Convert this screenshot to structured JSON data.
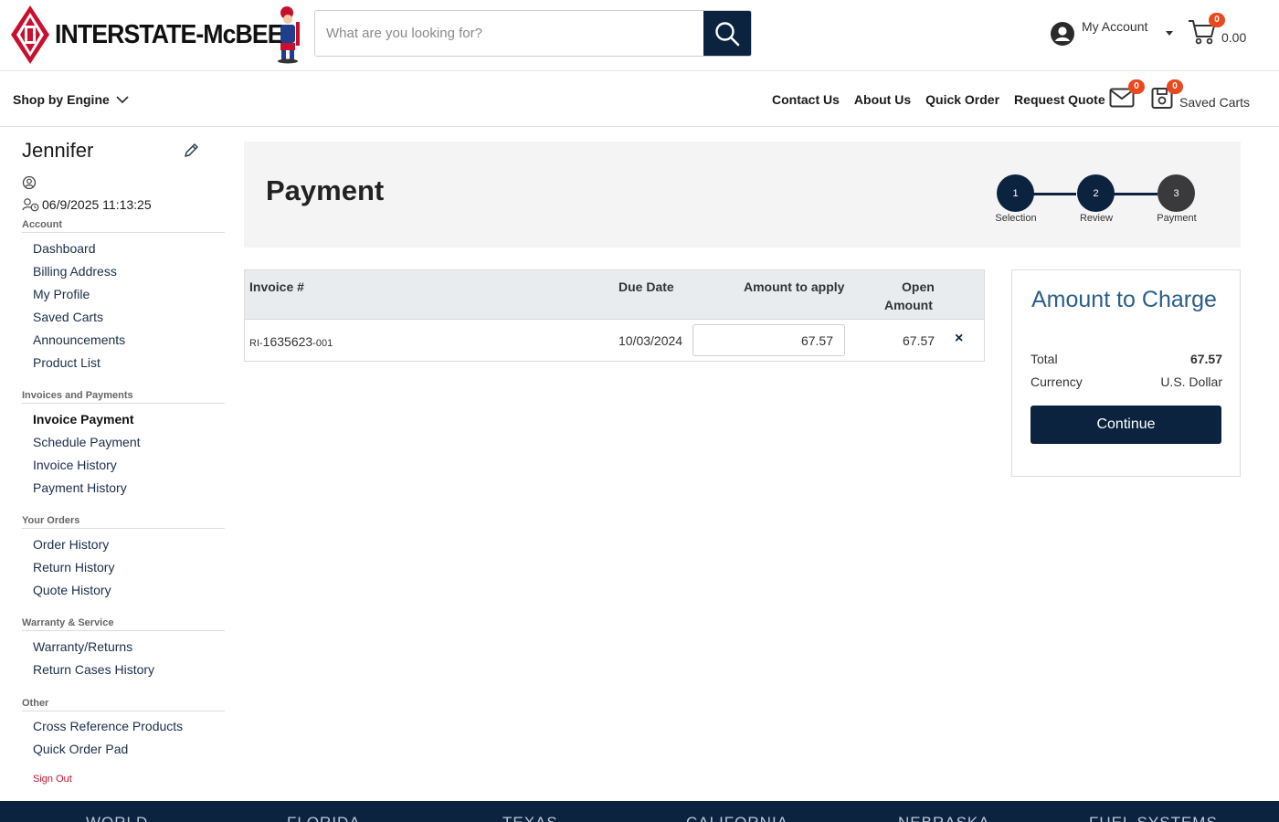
{
  "header": {
    "logo_text": "INTERSTATE-McBEE",
    "search_placeholder": "What are you looking for?",
    "account_label": "My Account",
    "cart_count": "0",
    "cart_total": "0.00"
  },
  "nav": {
    "shop_by_engine": "Shop by Engine",
    "links": [
      "Contact Us",
      "About Us",
      "Quick Order",
      "Request Quote"
    ],
    "mail_count": "0",
    "saved_count": "0",
    "saved_carts": "Saved Carts"
  },
  "sidebar": {
    "user_name": "Jennifer",
    "last_login": "06/9/2025 11:13:25",
    "sections": [
      {
        "title": "Account",
        "items": [
          "Dashboard",
          "Billing Address",
          "My Profile",
          "Saved Carts",
          "Announcements",
          "Product List"
        ]
      },
      {
        "title": "Invoices and Payments",
        "items": [
          "Invoice Payment",
          "Schedule Payment",
          "Invoice History",
          "Payment History"
        ]
      },
      {
        "title": "Your Orders",
        "items": [
          "Order History",
          "Return History",
          "Quote History"
        ]
      },
      {
        "title": "Warranty & Service",
        "items": [
          "Warranty/Returns",
          "Return Cases History"
        ]
      },
      {
        "title": "Other",
        "items": [
          "Cross Reference Products",
          "Quick Order Pad"
        ]
      }
    ],
    "sign_out": "Sign Out"
  },
  "banner": {
    "title": "Payment",
    "steps": [
      {
        "number": "1",
        "label": "Selection"
      },
      {
        "number": "2",
        "label": "Review"
      },
      {
        "number": "3",
        "label": "Payment"
      }
    ]
  },
  "table": {
    "headers": [
      "Invoice #",
      "Due Date",
      "Amount to apply",
      "Open",
      "Amount"
    ],
    "row": {
      "invoice_prefix": "RI-",
      "invoice_number": "1635623",
      "invoice_suffix": "-001",
      "due_date": "10/03/2024",
      "amount_to_apply": "67.57",
      "open_amount": "67.57",
      "remove": "×"
    }
  },
  "charge": {
    "title": "Amount to Charge",
    "total_label": "Total",
    "total_value": "67.57",
    "currency_label": "Currency",
    "currency_value": "U.S. Dollar",
    "continue": "Continue"
  },
  "footer": {
    "items": [
      "WORLD",
      "FLORIDA",
      "TEXAS",
      "CALIFORNIA",
      "NEBRASKA",
      "FUEL SYSTEMS"
    ]
  },
  "colors": {
    "navy": "#0c2340",
    "brand_red": "#c8102e",
    "badge": "#e8491d",
    "charge_title": "#2b5f8a"
  }
}
